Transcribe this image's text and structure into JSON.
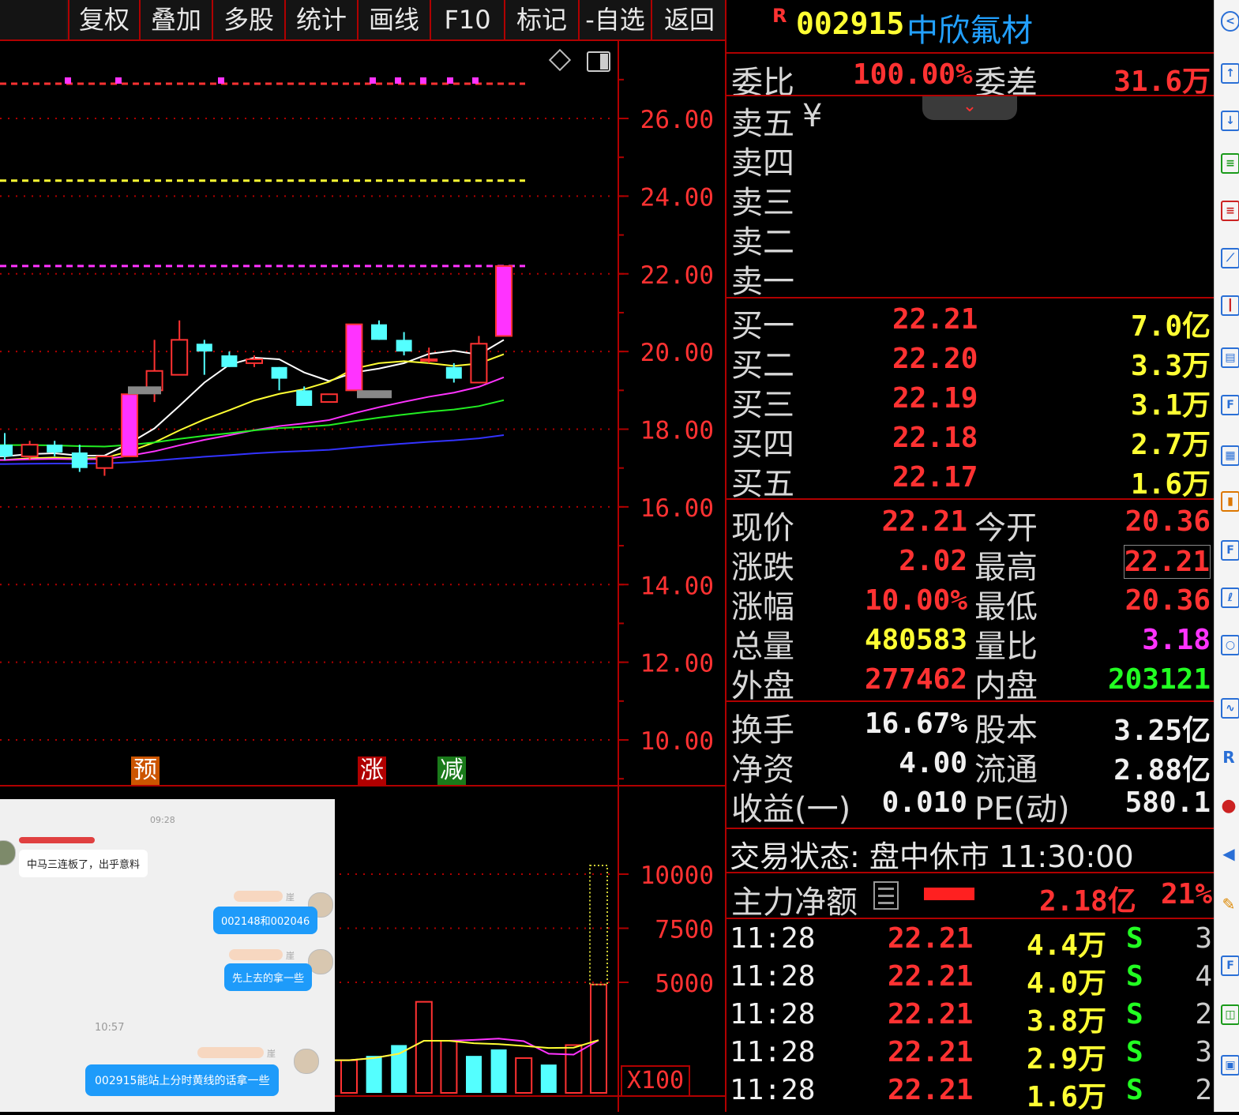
{
  "toolbar": {
    "buttons": [
      "复权",
      "叠加",
      "多股",
      "统计",
      "画线",
      "F10",
      "标记",
      "-自选",
      "返回"
    ]
  },
  "chart": {
    "price_axis": [
      "26.00",
      "24.00",
      "22.00",
      "20.00",
      "18.00",
      "16.00",
      "14.00",
      "12.00",
      "10.00"
    ],
    "volume_axis": [
      "10000",
      "7500",
      "5000"
    ],
    "volume_unit": "X100",
    "markers": [
      "预",
      "涨",
      "减"
    ],
    "colors": {
      "up": "#ff3232",
      "down": "#54ffff",
      "limit_up": "#ff33ff",
      "grid": "#b00000"
    }
  },
  "chart_data": {
    "type": "candlestick",
    "ylim": [
      9,
      27
    ],
    "candles": [
      {
        "o": 17.6,
        "h": 17.9,
        "l": 17.2,
        "c": 17.3
      },
      {
        "o": 17.3,
        "h": 17.7,
        "l": 17.2,
        "c": 17.6
      },
      {
        "o": 17.6,
        "h": 17.7,
        "l": 17.3,
        "c": 17.4
      },
      {
        "o": 17.4,
        "h": 17.6,
        "l": 16.9,
        "c": 17.0
      },
      {
        "o": 17.0,
        "h": 17.3,
        "l": 16.8,
        "c": 17.3
      },
      {
        "o": 17.3,
        "h": 18.9,
        "l": 17.3,
        "c": 18.9
      },
      {
        "o": 19.0,
        "h": 20.3,
        "l": 18.7,
        "c": 19.5
      },
      {
        "o": 19.4,
        "h": 20.8,
        "l": 19.4,
        "c": 20.3
      },
      {
        "o": 20.2,
        "h": 20.3,
        "l": 19.4,
        "c": 20.0
      },
      {
        "o": 19.9,
        "h": 20.0,
        "l": 19.6,
        "c": 19.6
      },
      {
        "o": 19.7,
        "h": 19.9,
        "l": 19.6,
        "c": 19.8
      },
      {
        "o": 19.6,
        "h": 19.6,
        "l": 19.0,
        "c": 19.3
      },
      {
        "o": 19.0,
        "h": 19.1,
        "l": 18.6,
        "c": 18.6
      },
      {
        "o": 18.7,
        "h": 18.9,
        "l": 18.7,
        "c": 18.9
      },
      {
        "o": 19.0,
        "h": 20.7,
        "l": 19.0,
        "c": 20.7
      },
      {
        "o": 20.7,
        "h": 20.8,
        "l": 20.3,
        "c": 20.3
      },
      {
        "o": 20.3,
        "h": 20.5,
        "l": 19.9,
        "c": 20.0
      },
      {
        "o": 19.8,
        "h": 20.1,
        "l": 19.7,
        "c": 19.8
      },
      {
        "o": 19.6,
        "h": 19.7,
        "l": 19.2,
        "c": 19.3
      },
      {
        "o": 19.2,
        "h": 20.4,
        "l": 19.2,
        "c": 20.2
      },
      {
        "o": 20.4,
        "h": 22.2,
        "l": 20.4,
        "c": 22.2
      }
    ],
    "volume": [
      1400,
      1600,
      2100,
      4100,
      2300,
      1600,
      1900,
      1500,
      1200,
      2100,
      4900
    ],
    "price_levels": [
      22.2,
      24.4
    ]
  },
  "quote": {
    "rtag": "R",
    "code": "002915",
    "name": "中欣氟材",
    "weibi_label": "委比",
    "weibi": "100.00%",
    "weicha_label": "委差",
    "weicha": "31.6万",
    "sell_labels": [
      "卖五",
      "卖四",
      "卖三",
      "卖二",
      "卖一"
    ],
    "currency_sign": "¥",
    "buy": [
      {
        "label": "买一",
        "price": "22.21",
        "vol": "7.0亿"
      },
      {
        "label": "买二",
        "price": "22.20",
        "vol": "3.3万"
      },
      {
        "label": "买三",
        "price": "22.19",
        "vol": "3.1万"
      },
      {
        "label": "买四",
        "price": "22.18",
        "vol": "2.7万"
      },
      {
        "label": "买五",
        "price": "22.17",
        "vol": "1.6万"
      }
    ],
    "stats": [
      {
        "l1": "现价",
        "v1": "22.21",
        "l2": "今开",
        "v2": "20.36"
      },
      {
        "l1": "涨跌",
        "v1": "2.02",
        "l2": "最高",
        "v2": "22.21"
      },
      {
        "l1": "涨幅",
        "v1": "10.00%",
        "l2": "最低",
        "v2": "20.36"
      },
      {
        "l1": "总量",
        "v1": "480583",
        "l2": "量比",
        "v2": "3.18"
      },
      {
        "l1": "外盘",
        "v1": "277462",
        "l2": "内盘",
        "v2": "203121"
      }
    ],
    "stats2": [
      {
        "l1": "换手",
        "v1": "16.67%",
        "l2": "股本",
        "v2": "3.25亿"
      },
      {
        "l1": "净资",
        "v1": "4.00",
        "l2": "流通",
        "v2": "2.88亿"
      },
      {
        "l1": "收益(一)",
        "v1": "0.010",
        "l2": "PE(动)",
        "v2": "580.1"
      }
    ],
    "status_text": "交易状态: 盘中休市 11:30:00",
    "main_force_label": "主力净额",
    "main_force_value": "2.18亿",
    "main_force_pct": "21%",
    "trades": [
      {
        "time": "11:28",
        "price": "22.21",
        "vol": "4.4万",
        "side": "S",
        "n": "3"
      },
      {
        "time": "11:28",
        "price": "22.21",
        "vol": "4.0万",
        "side": "S",
        "n": "4"
      },
      {
        "time": "11:28",
        "price": "22.21",
        "vol": "3.8万",
        "side": "S",
        "n": "2"
      },
      {
        "time": "11:28",
        "price": "22.21",
        "vol": "2.9万",
        "side": "S",
        "n": "3"
      },
      {
        "time": "11:28",
        "price": "22.21",
        "vol": "1.6万",
        "side": "S",
        "n": "2"
      }
    ]
  },
  "chat": {
    "time1": "09:28",
    "msg1": "中马三连板了，出乎意料",
    "msg2": "002148和002046",
    "msg3": "先上去的拿一些",
    "time2": "10:57",
    "msg4": "002915能站上分时黄线的话拿一些",
    "name_suffix": "崖"
  }
}
